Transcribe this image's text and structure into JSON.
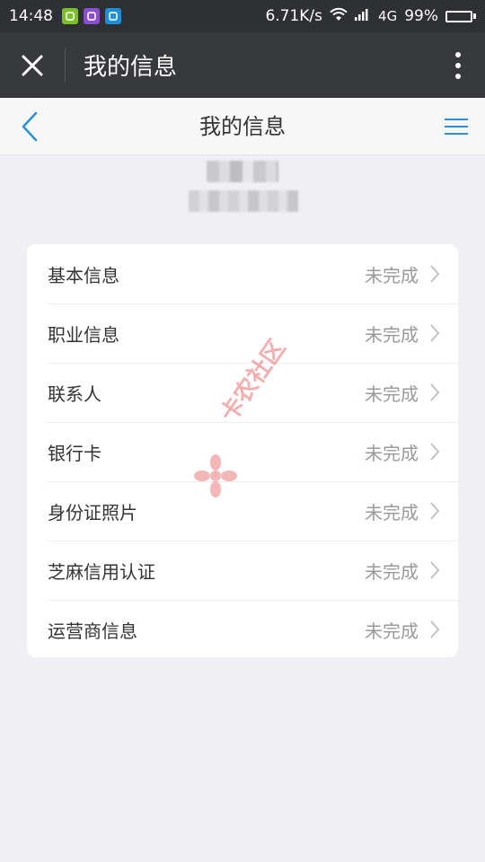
{
  "status_bar": {
    "time": "14:48",
    "net_speed": "6.71K/s",
    "network": "4G",
    "battery_text": "99%",
    "battery_level": 0.99
  },
  "title_bar": {
    "title": "我的信息"
  },
  "nav_bar": {
    "title": "我的信息"
  },
  "list": {
    "items": [
      {
        "label": "基本信息",
        "status": "未完成"
      },
      {
        "label": "职业信息",
        "status": "未完成"
      },
      {
        "label": "联系人",
        "status": "未完成"
      },
      {
        "label": "银行卡",
        "status": "未完成"
      },
      {
        "label": "身份证照片",
        "status": "未完成"
      },
      {
        "label": "芝麻信用认证",
        "status": "未完成"
      },
      {
        "label": "运营商信息",
        "status": "未完成"
      }
    ]
  },
  "watermark": {
    "text": "卡农社区"
  },
  "colors": {
    "accent": "#2b8fd6",
    "title_bar_bg": "#38393d",
    "status_bar_bg": "#2f3033",
    "page_bg": "#efeff4",
    "watermark": "#e96e6e"
  }
}
